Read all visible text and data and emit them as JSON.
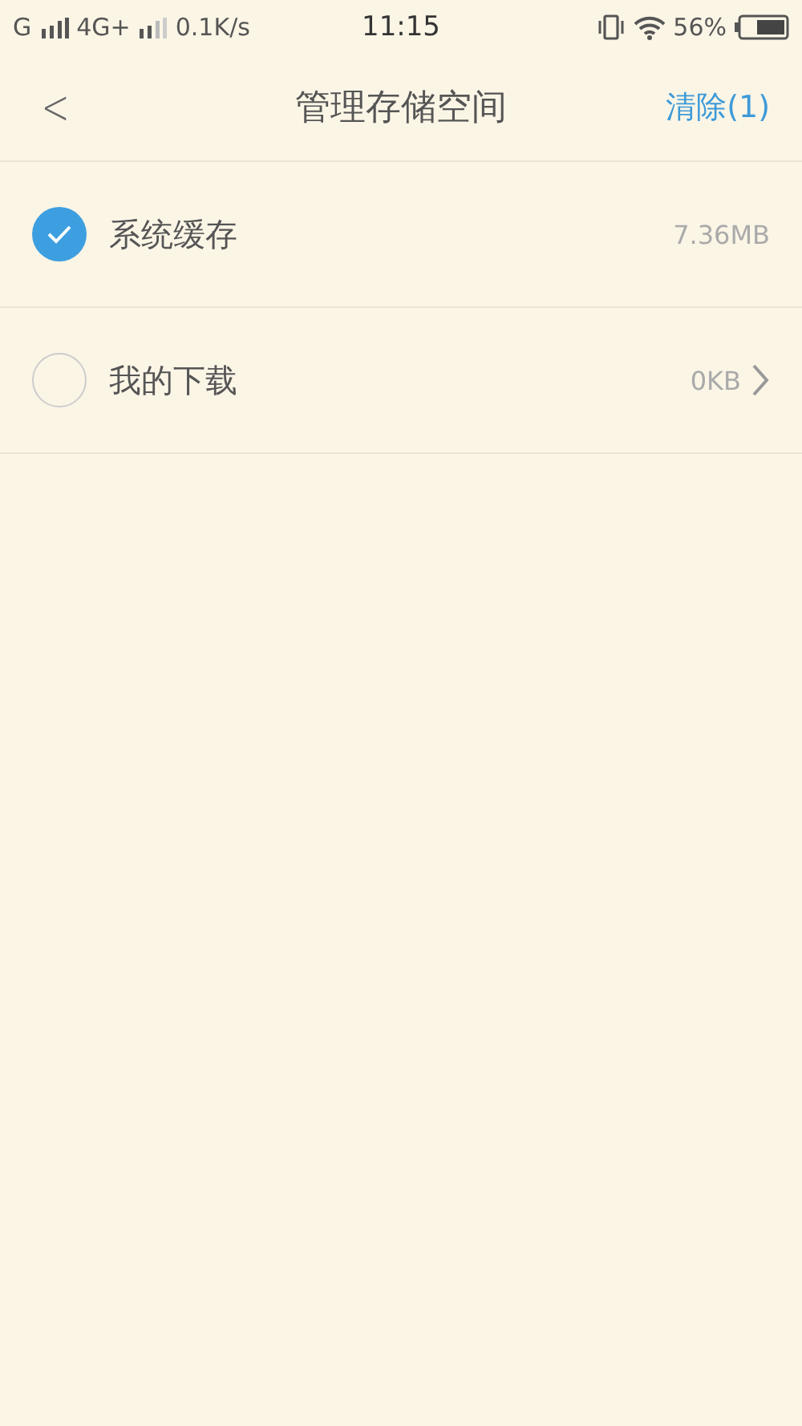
{
  "status_bar": {
    "carrier_1": "G",
    "carrier_2": "4G+",
    "speed": "0.1K/s",
    "time": "11:15",
    "battery": "56%"
  },
  "header": {
    "back": "<",
    "title": "管理存储空间",
    "action": "清除(1)"
  },
  "items": [
    {
      "label": "系统缓存",
      "size": "7.36MB",
      "checked": true,
      "has_arrow": false
    },
    {
      "label": "我的下载",
      "size": "0KB",
      "checked": false,
      "has_arrow": true
    }
  ]
}
